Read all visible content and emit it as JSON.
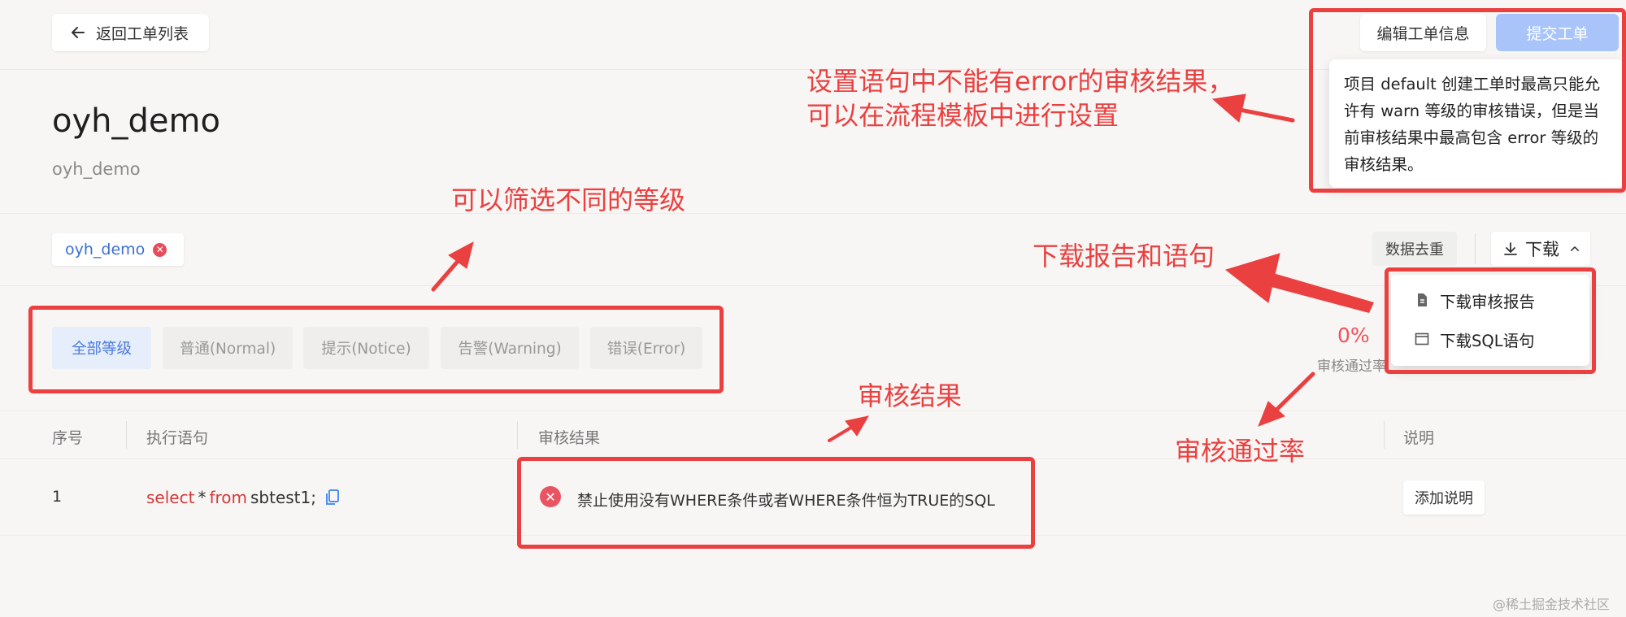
{
  "header": {
    "back_label": "返回工单列表",
    "edit_label": "编辑工单信息",
    "submit_label": "提交工单"
  },
  "order": {
    "title": "oyh_demo",
    "subtitle": "oyh_demo"
  },
  "tooltip": {
    "text": "项目 default 创建工单时最高只能允许有 warn 等级的审核错误，但是当前审核结果中最高包含 error 等级的审核结果。"
  },
  "filter": {
    "tag_label": "oyh_demo",
    "dedupe_label": "数据去重",
    "download_label": "下载",
    "levels": [
      "全部等级",
      "普通(Normal)",
      "提示(Notice)",
      "告警(Warning)",
      "错误(Error)"
    ]
  },
  "download_menu": {
    "report_label": "下载审核报告",
    "sql_label": "下载SQL语句"
  },
  "pass_rate": {
    "value": "0%",
    "label": "审核通过率"
  },
  "table": {
    "headers": [
      "序号",
      "执行语句",
      "审核结果",
      "说明"
    ],
    "rows": [
      {
        "index": "1",
        "sql_select": "select",
        "sql_star": "*",
        "sql_from": "from",
        "sql_table": "sbtest1;",
        "result": "禁止使用没有WHERE条件或者WHERE条件恒为TRUE的SQL",
        "action_label": "添加说明"
      }
    ]
  },
  "annotations": {
    "level_setting": [
      "设置语句中不能有error的审核结果，",
      "可以在流程模板中进行设置"
    ],
    "filter_levels": "可以筛选不同的等级",
    "download": "下载报告和语句",
    "audit_result": "审核结果",
    "pass_rate": "审核通过率"
  },
  "watermark": "@稀土掘金技术社区",
  "colors": {
    "accent_blue": "#4a7be0",
    "submit_disabled": "#a9c4f9",
    "error_red": "#e85562",
    "annotation_red": "#ea4040"
  }
}
